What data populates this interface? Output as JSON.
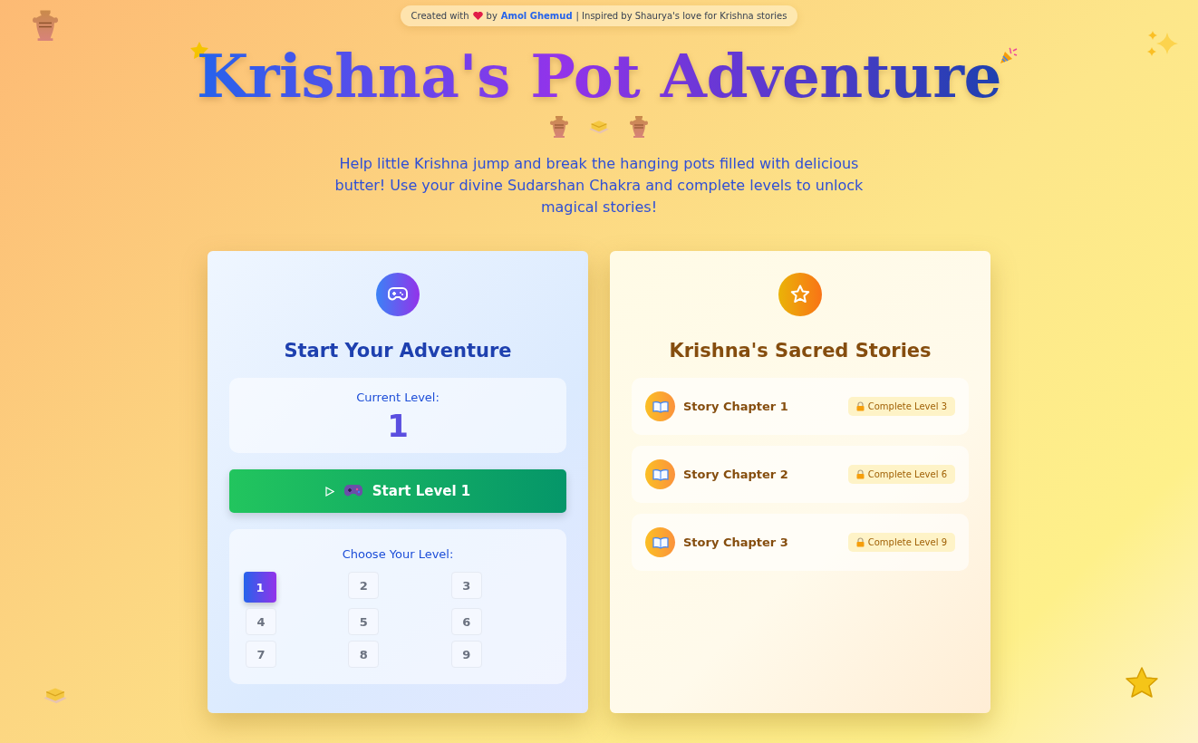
{
  "credit": {
    "prefix": "Created with",
    "by": "by",
    "author": "Amol Ghemud",
    "suffix": "| Inspired by Shaurya's love for Krishna stories"
  },
  "title": "Krishna's Pot Adventure",
  "subtitle": "Help little Krishna jump and break the hanging pots filled with delicious butter! Use your divine Sudarshan Chakra and complete levels to unlock magical stories!",
  "game_card": {
    "heading": "Start Your Adventure",
    "current_level_label": "Current Level:",
    "current_level": "1",
    "start_button": "Start Level 1",
    "choose_label": "Choose Your Level:",
    "levels": [
      {
        "label": "1",
        "selected": true
      },
      {
        "label": "2",
        "selected": false
      },
      {
        "label": "3",
        "selected": false
      },
      {
        "label": "4",
        "selected": false
      },
      {
        "label": "5",
        "selected": false
      },
      {
        "label": "6",
        "selected": false
      },
      {
        "label": "7",
        "selected": false
      },
      {
        "label": "8",
        "selected": false
      },
      {
        "label": "9",
        "selected": false
      }
    ]
  },
  "stories_card": {
    "heading": "Krishna's Sacred Stories",
    "chapters": [
      {
        "title": "Story Chapter 1",
        "requirement": "Complete Level 3",
        "locked": true
      },
      {
        "title": "Story Chapter 2",
        "requirement": "Complete Level 6",
        "locked": true
      },
      {
        "title": "Story Chapter 3",
        "requirement": "Complete Level 9",
        "locked": true
      }
    ]
  }
}
